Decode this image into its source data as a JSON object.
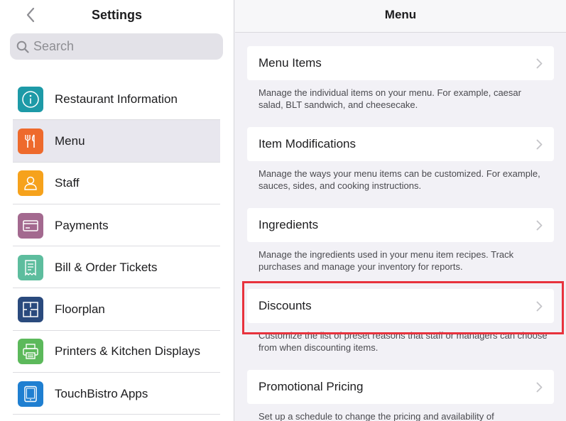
{
  "left_pane": {
    "title": "Settings",
    "search_placeholder": "Search",
    "items": [
      {
        "label": "Restaurant Information",
        "icon": "info-icon",
        "color": "#1d9aa7"
      },
      {
        "label": "Menu",
        "icon": "fork-knife-icon",
        "color": "#ee6a2c"
      },
      {
        "label": "Staff",
        "icon": "person-icon",
        "color": "#f6a21c"
      },
      {
        "label": "Payments",
        "icon": "card-icon",
        "color": "#a3698f"
      },
      {
        "label": "Bill & Order Tickets",
        "icon": "receipt-icon",
        "color": "#5dbd9e"
      },
      {
        "label": "Floorplan",
        "icon": "floorplan-icon",
        "color": "#2a4a7d"
      },
      {
        "label": "Printers & Kitchen Displays",
        "icon": "printer-icon",
        "color": "#5cb95b"
      },
      {
        "label": "TouchBistro Apps",
        "icon": "tablet-icon",
        "color": "#1f7fd1"
      }
    ],
    "selected_index": 1
  },
  "right_pane": {
    "title": "Menu",
    "sections": [
      {
        "label": "Menu Items",
        "description": "Manage the individual items on your menu. For example, caesar salad, BLT sandwich, and cheesecake."
      },
      {
        "label": "Item Modifications",
        "description": "Manage the ways your menu items can be customized. For example, sauces, sides, and cooking instructions."
      },
      {
        "label": "Ingredients",
        "description": "Manage the ingredients used in your menu item recipes. Track purchases and manage your inventory for reports."
      },
      {
        "label": "Discounts",
        "description": "Customize the list of preset reasons that staff or managers can choose from when discounting items."
      },
      {
        "label": "Promotional Pricing",
        "description": "Set up a schedule to change the pricing and availability of"
      }
    ],
    "highlighted_index": 3
  },
  "colors": {
    "accent": "#8e8e93",
    "highlight_border": "#e8323d",
    "selected_row": "#e8e7ee"
  }
}
